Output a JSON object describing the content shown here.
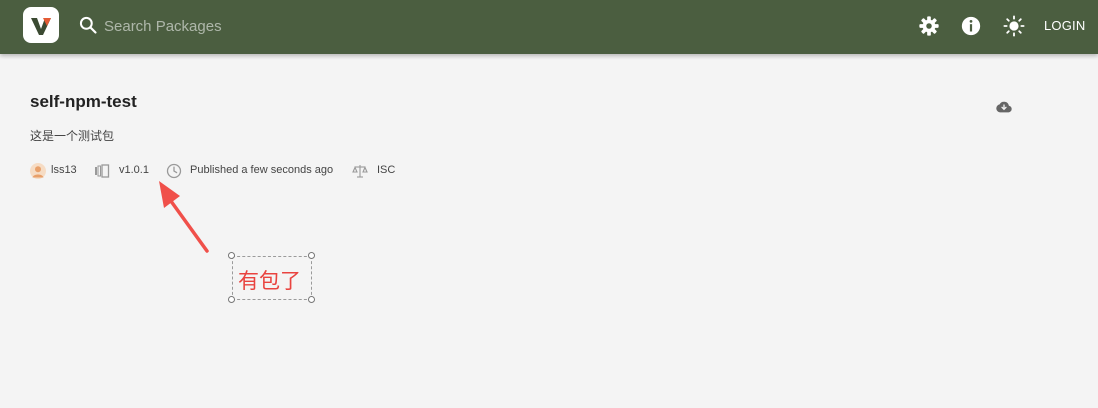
{
  "header": {
    "search": {
      "placeholder": "Search Packages",
      "value": ""
    },
    "login_label": "LOGIN",
    "icons": [
      "settings-icon",
      "info-icon",
      "theme-toggle-icon"
    ],
    "bg_color": "#4b5e40"
  },
  "package": {
    "name": "self-npm-test",
    "description": "这是一个测试包",
    "author": "lss13",
    "version": "v1.0.1",
    "published": "Published a few seconds ago",
    "license": "ISC"
  },
  "annotation": {
    "text": "有包了",
    "color": "#e9433f"
  }
}
